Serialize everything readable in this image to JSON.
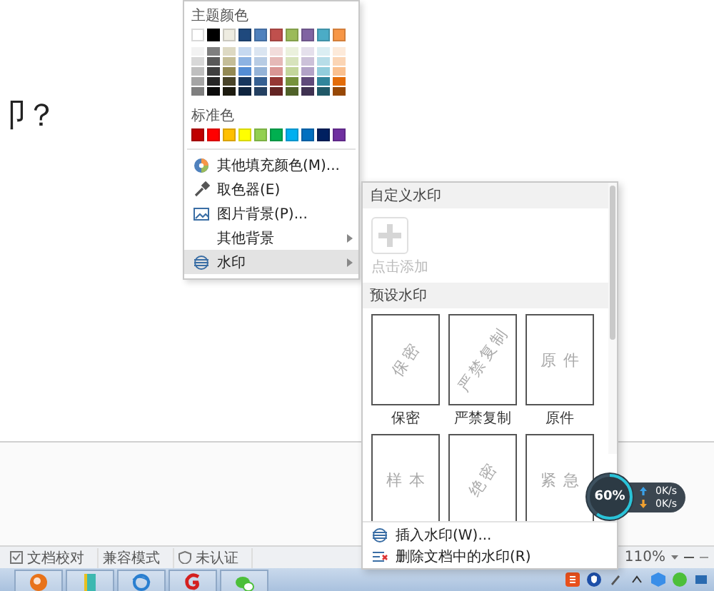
{
  "document": {
    "text": "卩？"
  },
  "color_menu": {
    "theme_heading": "主题颜色",
    "theme_colors": [
      {
        "color": "#ffffff",
        "shades": [
          {
            "color": "#f2f2f2"
          },
          {
            "color": "#d8d8d8"
          },
          {
            "color": "#bfbfbf"
          },
          {
            "color": "#a5a5a5"
          },
          {
            "color": "#7f7f7f"
          }
        ]
      },
      {
        "color": "#000000",
        "shades": [
          {
            "color": "#7f7f7f"
          },
          {
            "color": "#595959"
          },
          {
            "color": "#3f3f3f"
          },
          {
            "color": "#262626"
          },
          {
            "color": "#0c0c0c"
          }
        ]
      },
      {
        "color": "#eeece1",
        "shades": [
          {
            "color": "#ddd9c3"
          },
          {
            "color": "#c4bd97"
          },
          {
            "color": "#938953"
          },
          {
            "color": "#494429"
          },
          {
            "color": "#1d1b10"
          }
        ]
      },
      {
        "color": "#1f497d",
        "shades": [
          {
            "color": "#c6d9f0"
          },
          {
            "color": "#8db3e2"
          },
          {
            "color": "#548dd4"
          },
          {
            "color": "#17365d"
          },
          {
            "color": "#0f243e"
          }
        ]
      },
      {
        "color": "#4f81bd",
        "shades": [
          {
            "color": "#dbe5f1"
          },
          {
            "color": "#b8cce4"
          },
          {
            "color": "#95b3d7"
          },
          {
            "color": "#366092"
          },
          {
            "color": "#244061"
          }
        ]
      },
      {
        "color": "#c0504d",
        "shades": [
          {
            "color": "#f2dcdb"
          },
          {
            "color": "#e5b9b7"
          },
          {
            "color": "#d99694"
          },
          {
            "color": "#953734"
          },
          {
            "color": "#632423"
          }
        ]
      },
      {
        "color": "#9bbb59",
        "shades": [
          {
            "color": "#ebf1dd"
          },
          {
            "color": "#d7e3bc"
          },
          {
            "color": "#c3d69b"
          },
          {
            "color": "#76923c"
          },
          {
            "color": "#4f6128"
          }
        ]
      },
      {
        "color": "#8064a2",
        "shades": [
          {
            "color": "#e5e0ec"
          },
          {
            "color": "#ccc1d9"
          },
          {
            "color": "#b2a2c7"
          },
          {
            "color": "#5f497a"
          },
          {
            "color": "#3f3151"
          }
        ]
      },
      {
        "color": "#4bacc6",
        "shades": [
          {
            "color": "#dbeef3"
          },
          {
            "color": "#b7dde8"
          },
          {
            "color": "#92cddc"
          },
          {
            "color": "#31859b"
          },
          {
            "color": "#205867"
          }
        ]
      },
      {
        "color": "#f79646",
        "shades": [
          {
            "color": "#fdeada"
          },
          {
            "color": "#fbd5b5"
          },
          {
            "color": "#fac08f"
          },
          {
            "color": "#e36c09"
          },
          {
            "color": "#974806"
          }
        ]
      }
    ],
    "standard_heading": "标准色",
    "standard_colors": [
      {
        "color": "#c00000"
      },
      {
        "color": "#ff0000"
      },
      {
        "color": "#ffc000"
      },
      {
        "color": "#ffff00"
      },
      {
        "color": "#92d050"
      },
      {
        "color": "#00b050"
      },
      {
        "color": "#00b0f0"
      },
      {
        "color": "#0070c0"
      },
      {
        "color": "#002060"
      },
      {
        "color": "#7030a0"
      }
    ],
    "items": [
      {
        "label": "其他填充颜色(M)...",
        "kind": "palette",
        "submenu": false,
        "selected": false
      },
      {
        "label": "取色器(E)",
        "kind": "eyedropper",
        "submenu": false,
        "selected": false
      },
      {
        "label": "图片背景(P)...",
        "kind": "picture",
        "submenu": false,
        "selected": false
      },
      {
        "label": "其他背景",
        "kind": "plain",
        "submenu": true,
        "selected": false
      },
      {
        "label": "水印",
        "kind": "watermark",
        "submenu": true,
        "selected": true
      }
    ]
  },
  "watermark_menu": {
    "custom_heading": "自定义水印",
    "add_label": "点击添加",
    "preset_heading": "预设水印",
    "presets": [
      {
        "text": "保密",
        "label": "保密",
        "kind": "diagonal"
      },
      {
        "text": "严禁复制",
        "label": "严禁复制",
        "kind": "diagonal"
      },
      {
        "text": "原件",
        "label": "原件",
        "kind": "horizontal"
      },
      {
        "text": "样本",
        "kind": "horizontal"
      },
      {
        "text": "绝密",
        "kind": "diagonal"
      },
      {
        "text": "紧急",
        "kind": "horizontal"
      }
    ],
    "actions": [
      {
        "label": "插入水印(W)...",
        "kind": "insert"
      },
      {
        "label": "删除文档中的水印(R)",
        "kind": "delete"
      }
    ]
  },
  "net_widget": {
    "percent": "60%",
    "level": 0.6,
    "upload": "0K/s",
    "download": "0K/s"
  },
  "status_bar": {
    "items": [
      {
        "label": "文档校对",
        "kind": "check"
      },
      {
        "label": "兼容模式",
        "kind": "plain"
      },
      {
        "label": "未认证",
        "kind": "shield"
      }
    ],
    "zoom": "110%"
  }
}
